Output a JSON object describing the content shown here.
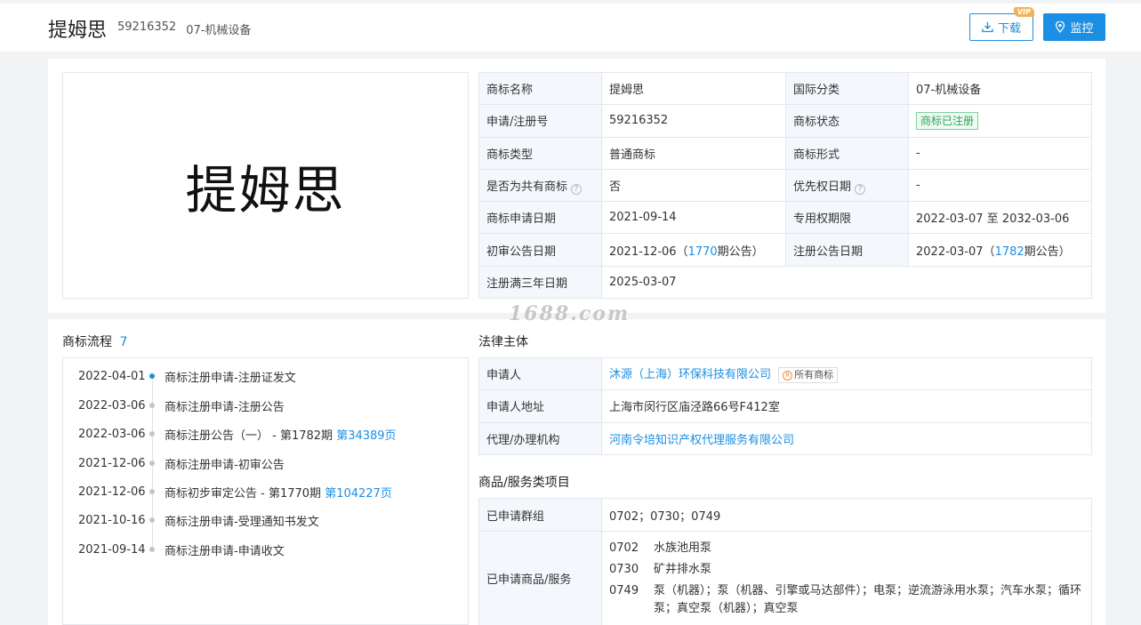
{
  "header": {
    "title": "提姆思",
    "reg_no": "59216352",
    "class": "07-机械设备",
    "download_label": "下载",
    "vip_label": "VIP",
    "monitor_label": "监控"
  },
  "trademark_image_text": "提姆思",
  "info": {
    "rows": [
      {
        "k1": "商标名称",
        "v1": "提姆思",
        "k2": "国际分类",
        "v2": "07-机械设备"
      },
      {
        "k1": "申请/注册号",
        "v1": "59216352",
        "k2": "商标状态",
        "v2": "商标已注册"
      },
      {
        "k1": "商标类型",
        "v1": "普通商标",
        "k2": "商标形式",
        "v2": "-"
      },
      {
        "k1": "是否为共有商标",
        "v1": "否",
        "k2": "优先权日期",
        "v2": "-"
      },
      {
        "k1": "商标申请日期",
        "v1": "2021-09-14",
        "k2": "专用权期限",
        "v2": "2022-03-07 至 2032-03-06"
      },
      {
        "k1": "初审公告日期",
        "v1a": "2021-12-06（",
        "v1b": "1770",
        "v1c": "期公告）",
        "k2": "注册公告日期",
        "v2a": "2022-03-07（",
        "v2b": "1782",
        "v2c": "期公告）"
      },
      {
        "k1": "注册满三年日期",
        "v1": "2025-03-07"
      }
    ],
    "help_mark": "?"
  },
  "watermark": "1688.com",
  "flow": {
    "title": "商标流程",
    "count": "7",
    "items": [
      {
        "date": "2022-04-01",
        "text": "商标注册申请-注册证发文",
        "link": ""
      },
      {
        "date": "2022-03-06",
        "text": "商标注册申请-注册公告",
        "link": ""
      },
      {
        "date": "2022-03-06",
        "text": "商标注册公告（一） - 第1782期 ",
        "link": "第34389页"
      },
      {
        "date": "2021-12-06",
        "text": "商标注册申请-初审公告",
        "link": ""
      },
      {
        "date": "2021-12-06",
        "text": "商标初步审定公告 - 第1770期 ",
        "link": "第104227页"
      },
      {
        "date": "2021-10-16",
        "text": "商标注册申请-受理通知书发文",
        "link": ""
      },
      {
        "date": "2021-09-14",
        "text": "商标注册申请-申请收文",
        "link": ""
      }
    ]
  },
  "legal": {
    "title": "法律主体",
    "applicant_label": "申请人",
    "applicant": "沐源（上海）环保科技有限公司",
    "all_marks_label": "所有商标",
    "r_mark": "R",
    "address_label": "申请人地址",
    "address": "上海市闵行区庙泾路66号F412室",
    "agent_label": "代理/办理机构",
    "agent": "河南令培知识产权代理服务有限公司"
  },
  "goods": {
    "title": "商品/服务类项目",
    "groups_label": "已申请群组",
    "groups": "0702；0730；0749",
    "services_label": "已申请商品/服务",
    "items": [
      {
        "code": "0702",
        "desc": "水族池用泵"
      },
      {
        "code": "0730",
        "desc": "矿井排水泵"
      },
      {
        "code": "0749",
        "desc": "泵（机器）；泵（机器、引擎或马达部件）；电泵；逆流游泳用水泵；汽车水泵；循环泵；真空泵（机器）；真空泵"
      }
    ]
  },
  "colors": {
    "accent": "#1a8fe3",
    "status_green": "#2fa35a",
    "key_bg": "#f4f8fd",
    "border": "#e4e7ec"
  }
}
